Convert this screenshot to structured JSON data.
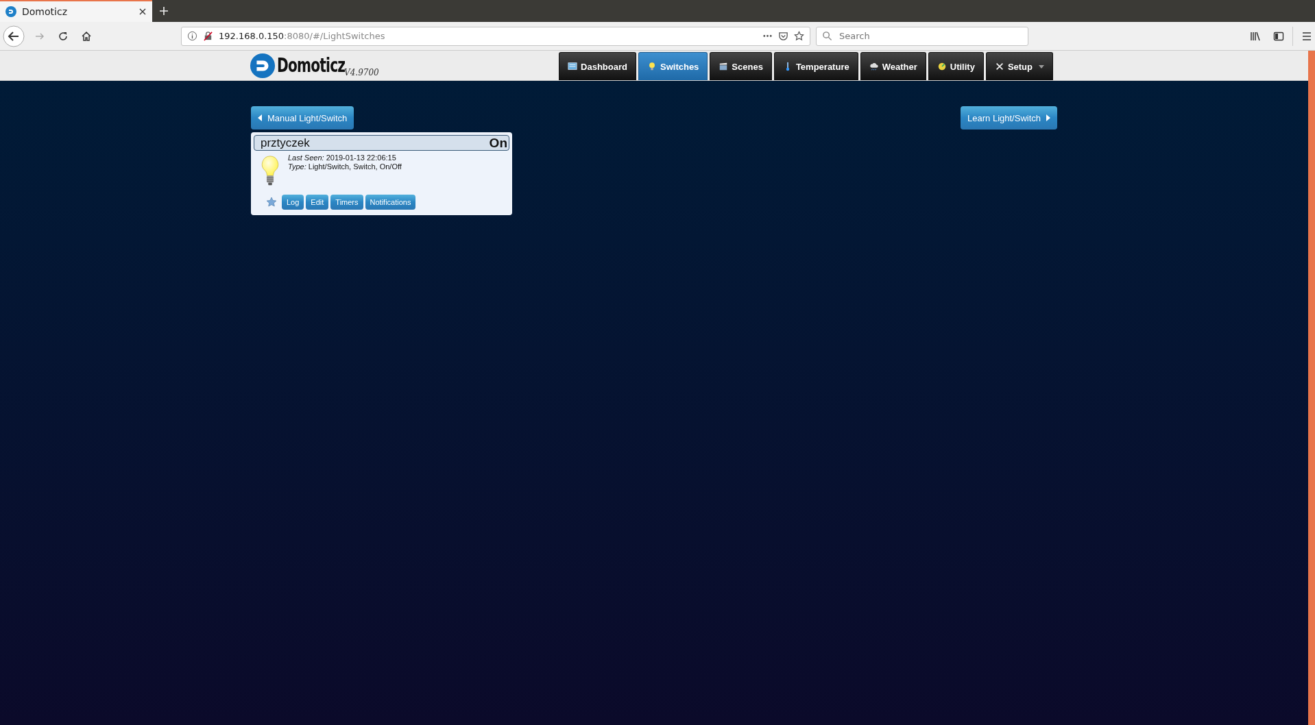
{
  "browser": {
    "tab_title": "Domoticz",
    "url_host": "192.168.0.150",
    "url_rest": ":8080/#/LightSwitches",
    "search_placeholder": "Search"
  },
  "header": {
    "logo_text": "Domoticz",
    "version": "V4.9700"
  },
  "nav": [
    {
      "label": "Dashboard",
      "kind": "dashboard",
      "selected": false
    },
    {
      "label": "Switches",
      "kind": "bulb",
      "selected": true
    },
    {
      "label": "Scenes",
      "kind": "clapper",
      "selected": false
    },
    {
      "label": "Temperature",
      "kind": "thermometer",
      "selected": false
    },
    {
      "label": "Weather",
      "kind": "cloud",
      "selected": false
    },
    {
      "label": "Utility",
      "kind": "utility",
      "selected": false
    },
    {
      "label": "Setup",
      "kind": "tools",
      "selected": false,
      "dropdown": true
    }
  ],
  "actions": {
    "left": "Manual Light/Switch",
    "right": "Learn Light/Switch"
  },
  "devices": [
    {
      "name": "prztyczek",
      "status": "On",
      "on": true,
      "last_seen": "*Last Seen:* 2019-01-13 22:06:15",
      "type": "*Type:* Light/Switch, Switch, On/Off",
      "buttons": [
        "Log",
        "Edit",
        "Timers",
        "Notifications"
      ]
    }
  ]
}
